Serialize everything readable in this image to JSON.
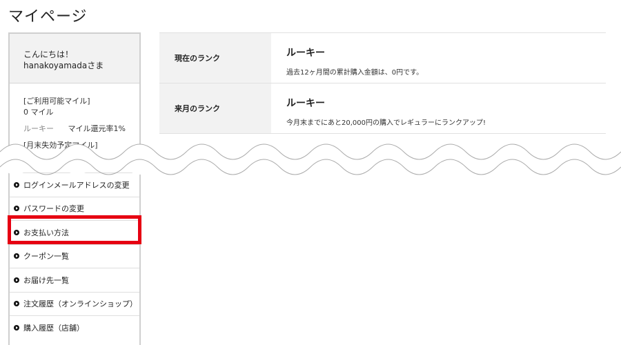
{
  "page": {
    "title": "マイページ"
  },
  "sidebar": {
    "greeting_line1": "こんにちは！",
    "greeting_line2": "hanakoyamadaさま",
    "miles": {
      "label": "[ご利用可能マイル]",
      "value": "0 マイル",
      "rank": "ルーキー",
      "rate": "マイル還元率1%",
      "next_label": "[月末失効予定マイル]"
    },
    "menu": [
      {
        "label": "ログインメールアドレスの変更"
      },
      {
        "label": "パスワードの変更"
      },
      {
        "label": "お支払い方法"
      },
      {
        "label": "クーポン一覧"
      },
      {
        "label": "お届け先一覧"
      },
      {
        "label": "注文履歴（オンラインショップ）"
      },
      {
        "label": "購入履歴（店舗）"
      }
    ]
  },
  "rank_table": {
    "rows": [
      {
        "label": "現在のランク",
        "name": "ルーキー",
        "desc": "過去12ヶ月間の累計購入金額は、0円です。"
      },
      {
        "label": "来月のランク",
        "name": "ルーキー",
        "desc": "今月末までにあと20,000円の購入でレギュラーにランクアップ!"
      }
    ]
  },
  "colors": {
    "highlight": "#e60012",
    "label_bg": "#f2f2f2",
    "border": "#e0e0e0"
  }
}
